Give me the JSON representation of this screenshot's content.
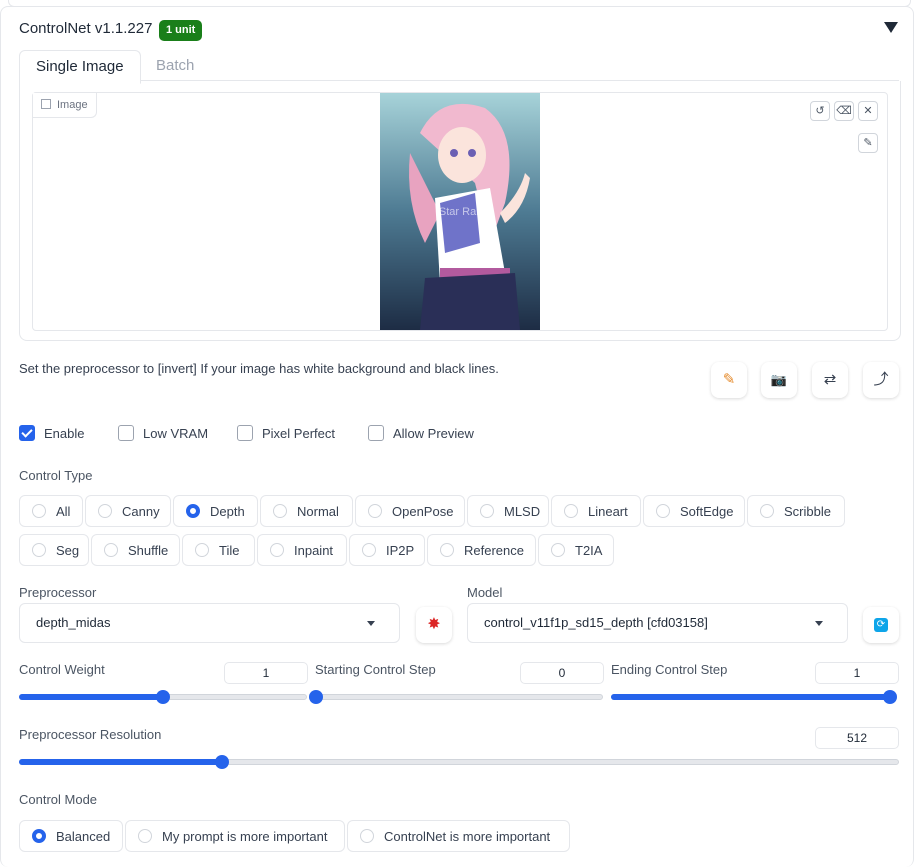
{
  "header": {
    "title": "ControlNet v1.1.227",
    "badge": "1 unit"
  },
  "tabs": [
    {
      "label": "Single Image"
    },
    {
      "label": "Batch"
    }
  ],
  "image_panel": {
    "label": "Image",
    "watermark": "Star Rail"
  },
  "hint": "Set the preprocessor to [invert] If your image has white background and black lines.",
  "options": [
    {
      "label": "Enable",
      "checked": true
    },
    {
      "label": "Low VRAM",
      "checked": false
    },
    {
      "label": "Pixel Perfect",
      "checked": false
    },
    {
      "label": "Allow Preview",
      "checked": false
    }
  ],
  "control_type": {
    "label": "Control Type",
    "selected": "Depth",
    "row1": [
      "All",
      "Canny",
      "Depth",
      "Normal",
      "OpenPose",
      "MLSD",
      "Lineart",
      "SoftEdge",
      "Scribble"
    ],
    "row2": [
      "Seg",
      "Shuffle",
      "Tile",
      "Inpaint",
      "IP2P",
      "Reference",
      "T2IA"
    ]
  },
  "preprocessor": {
    "label": "Preprocessor",
    "value": "depth_midas"
  },
  "model": {
    "label": "Model",
    "value": "control_v11f1p_sd15_depth [cfd03158]"
  },
  "control_weight": {
    "label": "Control Weight",
    "value": "1",
    "fraction": 0.5
  },
  "starting_step": {
    "label": "Starting Control Step",
    "value": "0",
    "fraction": 0.0
  },
  "ending_step": {
    "label": "Ending Control Step",
    "value": "1",
    "fraction": 1.0
  },
  "preprocessor_resolution": {
    "label": "Preprocessor Resolution",
    "value": "512",
    "fraction": 0.23
  },
  "control_mode": {
    "label": "Control Mode",
    "selected": "Balanced",
    "options": [
      "Balanced",
      "My prompt is more important",
      "ControlNet is more important"
    ]
  },
  "colors": {
    "accent": "#2563eb",
    "badge": "#1a7f1a",
    "explode": "#dc2626",
    "refresh": "#0ea5e9"
  }
}
